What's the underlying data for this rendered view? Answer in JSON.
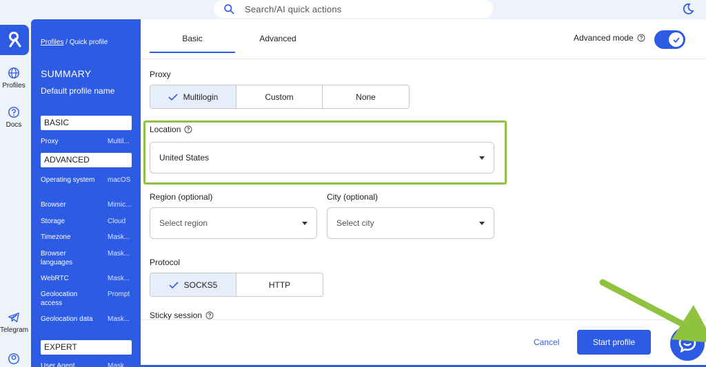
{
  "search": {
    "placeholder": "Search/AI quick actions"
  },
  "rail": {
    "items": [
      {
        "label": "Profiles",
        "icon": "globe-icon"
      },
      {
        "label": "Docs",
        "icon": "question-circle-icon"
      },
      {
        "label": "Telegram",
        "icon": "telegram-icon"
      },
      {
        "icon": "account-icon"
      }
    ]
  },
  "summary": {
    "breadcrumb_link": "Profiles",
    "breadcrumb_sep": "/",
    "breadcrumb_current": "Quick profile",
    "title": "SUMMARY",
    "profile_name": "Default profile name",
    "sections": {
      "basic": "BASIC",
      "advanced": "ADVANCED",
      "expert": "EXPERT"
    },
    "basic_rows": [
      {
        "key": "Proxy",
        "value": "Multil..."
      }
    ],
    "advanced_rows": [
      {
        "key": "Operating system",
        "value": "macOS"
      },
      {
        "key": "Browser",
        "value": "Mimic..."
      },
      {
        "key": "Storage",
        "value": "Cloud"
      },
      {
        "key": "Timezone",
        "value": "Mask..."
      },
      {
        "key": "Browser languages",
        "value": "Mask..."
      },
      {
        "key": "WebRTC",
        "value": "Mask..."
      },
      {
        "key": "Geolocation access",
        "value": "Prompt"
      },
      {
        "key": "Geolocation data",
        "value": "Mask..."
      }
    ],
    "expert_rows": [
      {
        "key": "User Agent",
        "value": "Mask..."
      }
    ]
  },
  "tabs": {
    "basic": "Basic",
    "advanced": "Advanced"
  },
  "advanced_mode": {
    "label": "Advanced mode",
    "enabled": true
  },
  "form": {
    "proxy": {
      "label": "Proxy",
      "options": [
        "Multilogin",
        "Custom",
        "None"
      ],
      "selected": "Multilogin"
    },
    "location": {
      "label": "Location",
      "value": "United States"
    },
    "region": {
      "label": "Region (optional)",
      "placeholder": "Select region"
    },
    "city": {
      "label": "City (optional)",
      "placeholder": "Select city"
    },
    "protocol": {
      "label": "Protocol",
      "options": [
        "SOCKS5",
        "HTTP"
      ],
      "selected": "SOCKS5"
    },
    "sticky_session": {
      "label": "Sticky session"
    }
  },
  "footer": {
    "cancel": "Cancel",
    "start": "Start profile"
  },
  "colors": {
    "accent": "#2d5be3",
    "highlight": "#8ec23f",
    "selected_bg": "#e8eef9"
  }
}
